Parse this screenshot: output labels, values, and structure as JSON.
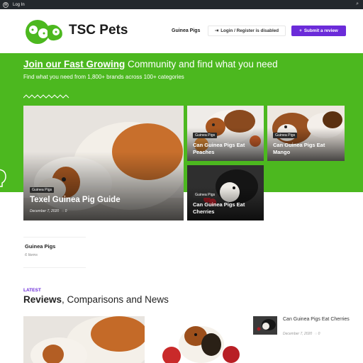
{
  "adminbar": {
    "login": "Log In"
  },
  "header": {
    "logo_text": "TSC Pets",
    "nav_item": "Guinea Pigs",
    "login_label": "Login / Register is disabled",
    "review_label": "Submit a review"
  },
  "hero": {
    "title_bold": "Join our Fast Growing",
    "title_rest": " Community and find what you need",
    "subtitle": "Find what you need from 1,800+ brands across 100+ categories"
  },
  "featured": {
    "tag": "Guinea Pigs",
    "title": "Texel Guinea Pig Guide",
    "date": "December 7, 2020",
    "comments": "0"
  },
  "cards": [
    {
      "tag": "Guinea Pigs",
      "title_l1": "Can Guinea Pigs Eat",
      "title_l2": "Peaches"
    },
    {
      "tag": "Guinea Pigs",
      "title_l1": "Can Guinea Pigs Eat",
      "title_l2": "Mango"
    },
    {
      "tag": "Guinea Pigs",
      "title_l1": "Can Guinea Pigs Eat",
      "title_l2": "Cherries"
    }
  ],
  "category": {
    "name": "Guinea Pigs",
    "count": "6 Items"
  },
  "latest": {
    "label": "LATEST",
    "title_bold": "Reviews",
    "title_rest": ", Comparisons and News"
  },
  "side_post": {
    "title": "Can Guinea Pigs Eat Cherries",
    "date": "December 7, 2020",
    "comments": "0"
  },
  "colors": {
    "green": "#4cb81f",
    "purple": "#6b2bd9",
    "adminbar": "#23282d"
  }
}
